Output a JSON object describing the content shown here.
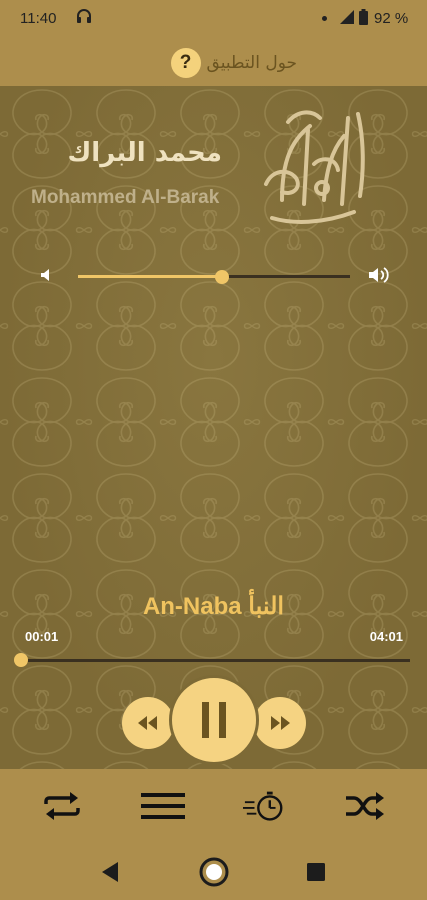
{
  "status_bar": {
    "time": "11:40",
    "battery_percent": "92 %",
    "battery_level": 0.92,
    "icons": [
      "headphones-icon",
      "notification-dot-icon",
      "signal-icon",
      "battery-icon"
    ]
  },
  "header": {
    "about_label": "حول التطبيق",
    "help_icon_glyph": "?"
  },
  "reciter": {
    "name_ar": "محمد البراك",
    "name_en": "Mohammed Al-Barak",
    "logo": "quran-calligraphy-logo"
  },
  "volume": {
    "level": 0.53
  },
  "track": {
    "title": "An-Naba النبأ",
    "elapsed": "00:01",
    "duration": "04:01",
    "progress": 0.004
  },
  "controls": {
    "previous": "rewind-icon",
    "play_pause": "pause-icon",
    "next": "fast-forward-icon"
  },
  "toolbar": {
    "items": [
      "repeat-icon",
      "playlist-icon",
      "sleep-timer-icon",
      "shuffle-icon"
    ]
  },
  "navbar": {
    "items": [
      "back-icon",
      "home-icon",
      "recents-icon"
    ]
  },
  "colors": {
    "bar_bg": "#ad8e4c",
    "main_bg": "#7d6a36",
    "accent": "#f0c667",
    "title_accent": "#f0c35f"
  }
}
